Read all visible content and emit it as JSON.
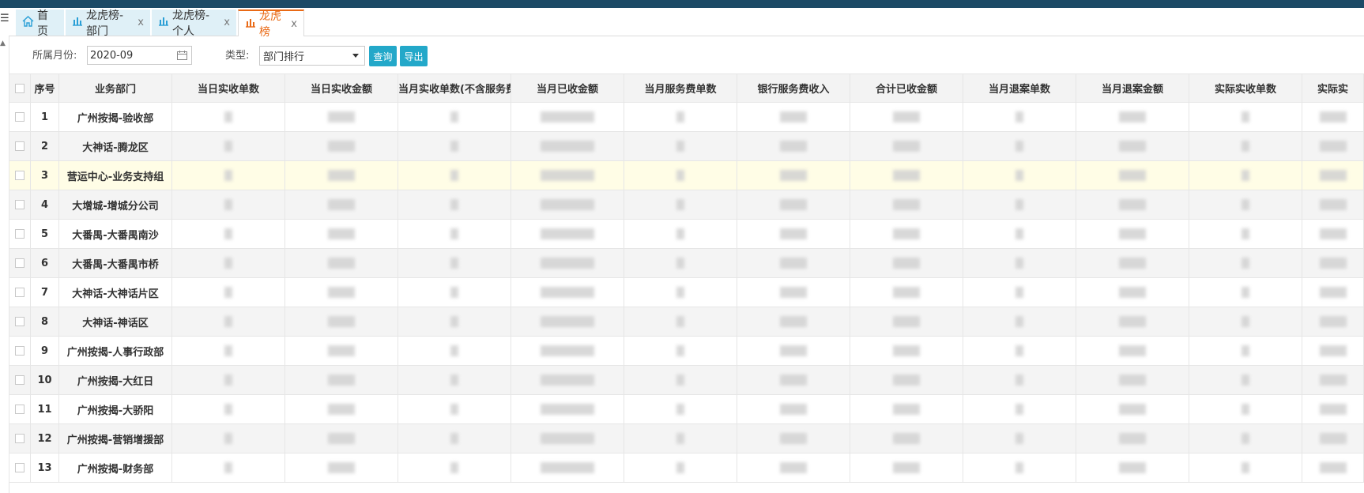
{
  "tabs": [
    {
      "label": "首页",
      "icon": "home-icon"
    },
    {
      "label": "龙虎榜-部门",
      "icon": "bar-chart-icon"
    },
    {
      "label": "龙虎榜-个人",
      "icon": "bar-chart-icon"
    },
    {
      "label": "龙虎榜",
      "icon": "bar-chart-icon",
      "active": true
    }
  ],
  "tab_close_glyph": "x",
  "filters": {
    "month_label": "所属月份:",
    "month_value": "2020-09",
    "type_label": "类型:",
    "type_value": "部门排行",
    "query_button": "查询",
    "export_button": "导出"
  },
  "table": {
    "columns": [
      "序号",
      "业务部门",
      "当日实收单数",
      "当日实收金额",
      "当月实收单数(不含服务费",
      "当月已收金额",
      "当月服务费单数",
      "银行服务费收入",
      "合计已收金额",
      "当月退案单数",
      "当月退案金额",
      "实际实收单数",
      "实际实"
    ],
    "rows": [
      {
        "no": "1",
        "dept": "广州按揭-验收部"
      },
      {
        "no": "2",
        "dept": "大神话-腾龙区"
      },
      {
        "no": "3",
        "dept": "营运中心-业务支持组"
      },
      {
        "no": "4",
        "dept": "大增城-增城分公司"
      },
      {
        "no": "5",
        "dept": "大番禺-大番禺南沙"
      },
      {
        "no": "6",
        "dept": "大番禺-大番禺市桥"
      },
      {
        "no": "7",
        "dept": "大神话-大神话片区"
      },
      {
        "no": "8",
        "dept": "大神话-神话区"
      },
      {
        "no": "9",
        "dept": "广州按揭-人事行政部"
      },
      {
        "no": "10",
        "dept": "广州按揭-大红日"
      },
      {
        "no": "11",
        "dept": "广州按揭-大骄阳"
      },
      {
        "no": "12",
        "dept": "广州按揭-营销增援部"
      },
      {
        "no": "13",
        "dept": "广州按揭-财务部"
      }
    ]
  },
  "colors": {
    "accent": "#23a8c9",
    "active_tab": "#e96a16",
    "topbar": "#1c4a66",
    "highlight_row": "#fffde6"
  }
}
